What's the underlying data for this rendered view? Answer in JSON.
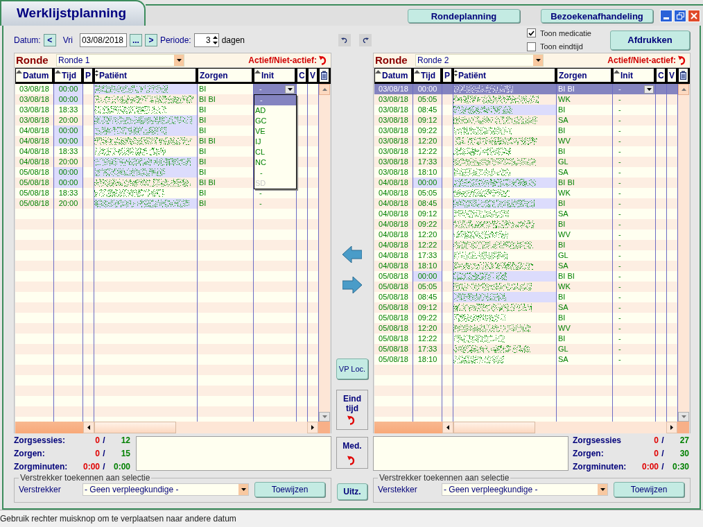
{
  "window": {
    "title": "Werklijstplanning"
  },
  "top_buttons": [
    "Rondeplanning",
    "Bezoekenafhandeling"
  ],
  "toolbar": {
    "date_label": "Datum:",
    "prev": "<",
    "day": "Vri",
    "date": "03/08/2018",
    "picker": "...",
    "next": ">",
    "period_label": "Periode:",
    "period": "3",
    "period_unit": "dagen"
  },
  "options": [
    {
      "label": "Toon medicatie",
      "checked": true
    },
    {
      "label": "Toon eindtijd",
      "checked": false
    }
  ],
  "print_button": "Afdrukken",
  "panels": [
    {
      "ronde_label": "Ronde",
      "ronde": "Ronde 1",
      "active_label": "Actief/Niet-actief:",
      "columns": [
        {
          "label": "Datum",
          "kind": "asc"
        },
        {
          "label": "Tijd",
          "kind": "asc"
        },
        {
          "label": "P",
          "kind": "plain"
        },
        {
          "label": "Patiënt",
          "kind": "both"
        },
        {
          "label": "Zorgen",
          "kind": "plain"
        },
        {
          "label": "Init",
          "kind": "asc"
        },
        {
          "label": "C",
          "kind": "plain"
        },
        {
          "label": "V",
          "kind": "plain"
        }
      ],
      "rows": [
        {
          "date": "03/08/18",
          "time": "00:00",
          "zorgen": "BI",
          "init": "-",
          "selected": false,
          "editing": true,
          "time_highlight": true,
          "patient_highlight": true
        },
        {
          "date": "03/08/18",
          "time": "00:00",
          "zorgen": "BI BI",
          "selected": false,
          "editing": false,
          "time_highlight": true,
          "patient_highlight": false
        },
        {
          "date": "03/08/18",
          "time": "18:33",
          "zorgen": "BI",
          "selected": false,
          "editing": false,
          "time_highlight": false,
          "patient_highlight": false
        },
        {
          "date": "03/08/18",
          "time": "20:00",
          "zorgen": "BI",
          "selected": false,
          "editing": false,
          "time_highlight": false,
          "patient_highlight": true
        },
        {
          "date": "04/08/18",
          "time": "00:00",
          "zorgen": "BI",
          "selected": false,
          "editing": false,
          "time_highlight": true,
          "patient_highlight": true
        },
        {
          "date": "04/08/18",
          "time": "00:00",
          "zorgen": "BI BI",
          "selected": false,
          "editing": false,
          "time_highlight": true,
          "patient_highlight": false
        },
        {
          "date": "04/08/18",
          "time": "18:33",
          "zorgen": "BI",
          "selected": false,
          "editing": false,
          "time_highlight": false,
          "patient_highlight": false
        },
        {
          "date": "04/08/18",
          "time": "20:00",
          "zorgen": "BI",
          "selected": false,
          "editing": false,
          "time_highlight": false,
          "patient_highlight": true
        },
        {
          "date": "05/08/18",
          "time": "00:00",
          "zorgen": "BI",
          "selected": false,
          "editing": false,
          "time_highlight": true,
          "patient_highlight": true
        },
        {
          "date": "05/08/18",
          "time": "00:00",
          "zorgen": "BI BI",
          "selected": false,
          "editing": false,
          "time_highlight": true,
          "patient_highlight": false
        },
        {
          "date": "05/08/18",
          "time": "18:33",
          "zorgen": "BI",
          "init": "-",
          "selected": false,
          "editing": false,
          "time_highlight": false,
          "patient_highlight": false
        },
        {
          "date": "05/08/18",
          "time": "20:00",
          "zorgen": "BI",
          "init": "-",
          "selected": false,
          "editing": false,
          "time_highlight": false,
          "patient_highlight": true
        }
      ],
      "dropdown": [
        {
          "label": "-",
          "selected": true,
          "disabled": false
        },
        {
          "label": "AD",
          "selected": false,
          "disabled": false
        },
        {
          "label": "GC",
          "selected": false,
          "disabled": false
        },
        {
          "label": "VE",
          "selected": false,
          "disabled": false
        },
        {
          "label": "IJ",
          "selected": false,
          "disabled": false
        },
        {
          "label": "CL",
          "selected": false,
          "disabled": false
        },
        {
          "label": "NC",
          "selected": false,
          "disabled": false
        },
        {
          "label": "-",
          "selected": false,
          "disabled": false
        },
        {
          "label": "SD",
          "selected": false,
          "disabled": true
        }
      ],
      "stats": [
        {
          "label": "Zorgsessies:",
          "done": "0",
          "divider": "/",
          "total": "12"
        },
        {
          "label": "Zorgen:",
          "done": "0",
          "divider": "/",
          "total": "15"
        },
        {
          "label": "Zorgminuten:",
          "done": "0:00",
          "divider": "/",
          "total": "0:00"
        }
      ],
      "assign": {
        "legend": "Verstrekker toekennen aan selectie",
        "label": "Verstrekker",
        "value": "- Geen verpleegkundige -",
        "button": "Toewijzen"
      }
    },
    {
      "ronde_label": "Ronde",
      "ronde": "Ronde 2",
      "active_label": "Actief/Niet-actief:",
      "columns": [
        {
          "label": "Datum",
          "kind": "asc"
        },
        {
          "label": "Tijd",
          "kind": "asc"
        },
        {
          "label": "P",
          "kind": "plain"
        },
        {
          "label": "Patiënt",
          "kind": "both"
        },
        {
          "label": "Zorgen",
          "kind": "plain"
        },
        {
          "label": "Init",
          "kind": "asc"
        },
        {
          "label": "C",
          "kind": "plain"
        },
        {
          "label": "V",
          "kind": "plain"
        }
      ],
      "rows": [
        {
          "date": "03/08/18",
          "time": "00:00",
          "zorgen": "BI BI",
          "init": "-",
          "selected": true,
          "editing": true,
          "time_highlight": false,
          "patient_highlight": false
        },
        {
          "date": "03/08/18",
          "time": "05:05",
          "zorgen": "WK",
          "init": "-",
          "selected": false,
          "editing": false,
          "time_highlight": false,
          "patient_highlight": false
        },
        {
          "date": "03/08/18",
          "time": "08:45",
          "zorgen": "BI",
          "init": "-",
          "selected": false,
          "editing": false,
          "time_highlight": false,
          "patient_highlight": true
        },
        {
          "date": "03/08/18",
          "time": "09:12",
          "zorgen": "SA",
          "init": "-",
          "selected": false,
          "editing": false,
          "time_highlight": false,
          "patient_highlight": false
        },
        {
          "date": "03/08/18",
          "time": "09:22",
          "zorgen": "BI",
          "init": "-",
          "selected": false,
          "editing": false,
          "time_highlight": false,
          "patient_highlight": false
        },
        {
          "date": "03/08/18",
          "time": "12:20",
          "zorgen": "WV",
          "init": "-",
          "selected": false,
          "editing": false,
          "time_highlight": false,
          "patient_highlight": false
        },
        {
          "date": "03/08/18",
          "time": "12:22",
          "zorgen": "BI",
          "init": "-",
          "selected": false,
          "editing": false,
          "time_highlight": false,
          "patient_highlight": false
        },
        {
          "date": "03/08/18",
          "time": "17:33",
          "zorgen": "GL",
          "init": "-",
          "selected": false,
          "editing": false,
          "time_highlight": false,
          "patient_highlight": false
        },
        {
          "date": "03/08/18",
          "time": "18:10",
          "zorgen": "SA",
          "init": "-",
          "selected": false,
          "editing": false,
          "time_highlight": false,
          "patient_highlight": false
        },
        {
          "date": "04/08/18",
          "time": "00:00",
          "zorgen": "BI BI",
          "init": "-",
          "selected": false,
          "editing": false,
          "time_highlight": true,
          "patient_highlight": true
        },
        {
          "date": "04/08/18",
          "time": "05:05",
          "zorgen": "WK",
          "init": "-",
          "selected": false,
          "editing": false,
          "time_highlight": false,
          "patient_highlight": false
        },
        {
          "date": "04/08/18",
          "time": "08:45",
          "zorgen": "BI",
          "init": "-",
          "selected": false,
          "editing": false,
          "time_highlight": false,
          "patient_highlight": true
        },
        {
          "date": "04/08/18",
          "time": "09:12",
          "zorgen": "SA",
          "init": "-",
          "selected": false,
          "editing": false,
          "time_highlight": false,
          "patient_highlight": false
        },
        {
          "date": "04/08/18",
          "time": "09:22",
          "zorgen": "BI",
          "init": "-",
          "selected": false,
          "editing": false,
          "time_highlight": false,
          "patient_highlight": false
        },
        {
          "date": "04/08/18",
          "time": "12:20",
          "zorgen": "WV",
          "init": "-",
          "selected": false,
          "editing": false,
          "time_highlight": false,
          "patient_highlight": false
        },
        {
          "date": "04/08/18",
          "time": "12:22",
          "zorgen": "BI",
          "init": "-",
          "selected": false,
          "editing": false,
          "time_highlight": false,
          "patient_highlight": false
        },
        {
          "date": "04/08/18",
          "time": "17:33",
          "zorgen": "GL",
          "init": "-",
          "selected": false,
          "editing": false,
          "time_highlight": false,
          "patient_highlight": false
        },
        {
          "date": "04/08/18",
          "time": "18:10",
          "zorgen": "SA",
          "init": "-",
          "selected": false,
          "editing": false,
          "time_highlight": false,
          "patient_highlight": false
        },
        {
          "date": "05/08/18",
          "time": "00:00",
          "zorgen": "BI BI",
          "init": "-",
          "selected": false,
          "editing": false,
          "time_highlight": true,
          "patient_highlight": true
        },
        {
          "date": "05/08/18",
          "time": "05:05",
          "zorgen": "WK",
          "init": "-",
          "selected": false,
          "editing": false,
          "time_highlight": false,
          "patient_highlight": false
        },
        {
          "date": "05/08/18",
          "time": "08:45",
          "zorgen": "BI",
          "init": "-",
          "selected": false,
          "editing": false,
          "time_highlight": false,
          "patient_highlight": true
        },
        {
          "date": "05/08/18",
          "time": "09:12",
          "zorgen": "SA",
          "init": "-",
          "selected": false,
          "editing": false,
          "time_highlight": false,
          "patient_highlight": false
        },
        {
          "date": "05/08/18",
          "time": "09:22",
          "zorgen": "BI",
          "init": "-",
          "selected": false,
          "editing": false,
          "time_highlight": false,
          "patient_highlight": false
        },
        {
          "date": "05/08/18",
          "time": "12:20",
          "zorgen": "WV",
          "init": "-",
          "selected": false,
          "editing": false,
          "time_highlight": false,
          "patient_highlight": false
        },
        {
          "date": "05/08/18",
          "time": "12:22",
          "zorgen": "BI",
          "init": "-",
          "selected": false,
          "editing": false,
          "time_highlight": false,
          "patient_highlight": false
        },
        {
          "date": "05/08/18",
          "time": "17:33",
          "zorgen": "GL",
          "init": "-",
          "selected": false,
          "editing": false,
          "time_highlight": false,
          "patient_highlight": false
        },
        {
          "date": "05/08/18",
          "time": "18:10",
          "zorgen": "SA",
          "init": "-",
          "selected": false,
          "editing": false,
          "time_highlight": false,
          "patient_highlight": false
        }
      ],
      "stats": [
        {
          "label": "Zorgsessies",
          "done": "0",
          "divider": "/",
          "total": "27"
        },
        {
          "label": "Zorgen:",
          "done": "0",
          "divider": "/",
          "total": "30"
        },
        {
          "label": "Zorgminuten:",
          "done": "0:00",
          "divider": "/",
          "total": "0:30"
        }
      ],
      "assign": {
        "legend": "Verstrekker toekennen aan selectie",
        "label": "Verstekker",
        "value": "- Geen verpleegkundige -",
        "button": "Toewijzen"
      }
    }
  ],
  "middle": {
    "vp_button": "VP Loc.",
    "end_time": "Eind tijd",
    "medication": "Med.",
    "exclude": "Uitz."
  },
  "status_bar": "Gebruik rechter muisknop om te verplaatsen naar andere datum"
}
